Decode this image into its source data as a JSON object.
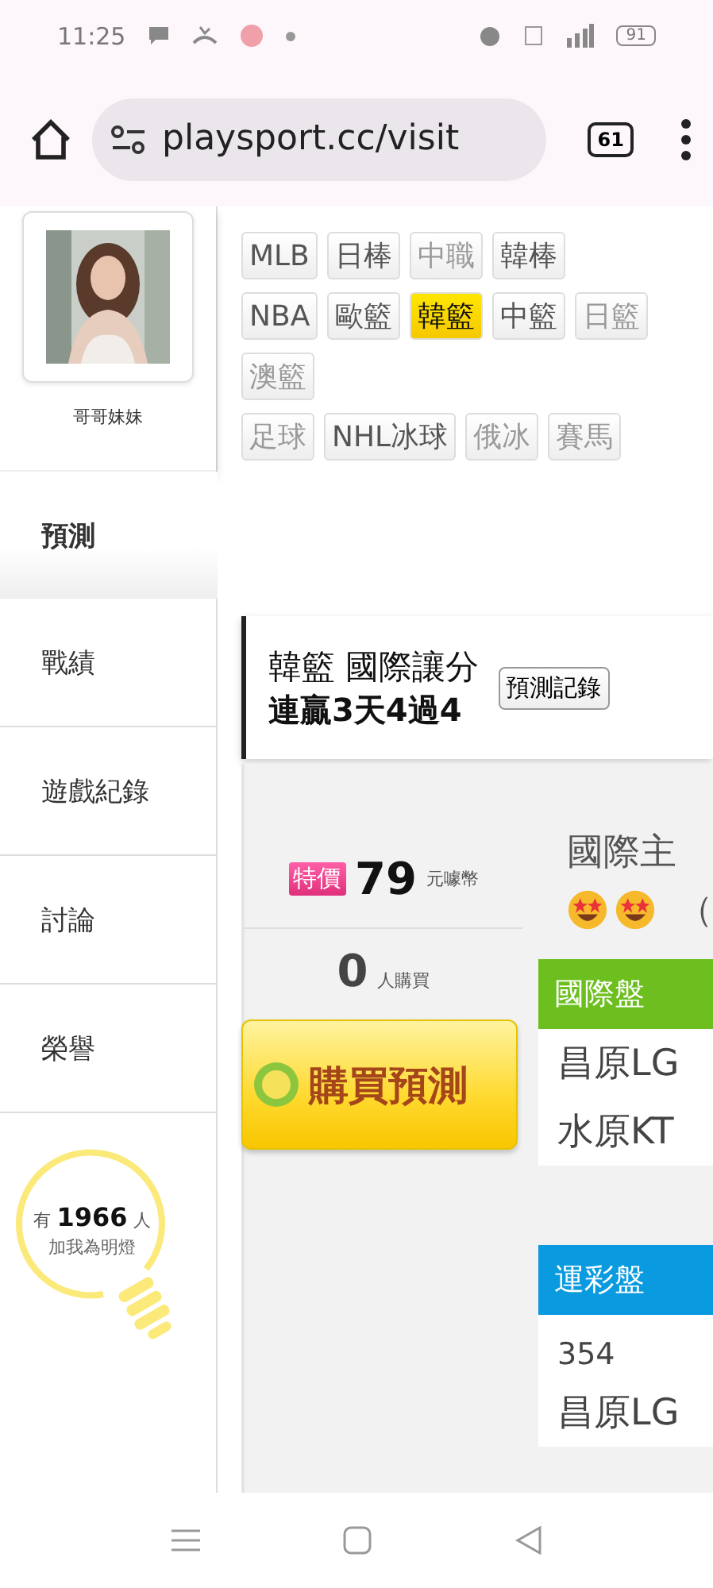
{
  "status_bar": {
    "time": "11:25",
    "battery": "91"
  },
  "browser": {
    "url": "playsport.cc/visit",
    "tab_count": "61"
  },
  "profile": {
    "name": "哥哥妹妹"
  },
  "nav": [
    {
      "label": "預測",
      "selected": true
    },
    {
      "label": "戰績",
      "selected": false
    },
    {
      "label": "遊戲紀錄",
      "selected": false
    },
    {
      "label": "討論",
      "selected": false
    },
    {
      "label": "榮譽",
      "selected": false
    }
  ],
  "fan_widget": {
    "count_text": "有 **1966** 人",
    "caption": "加我為明燈"
  },
  "tag_groups": [
    [
      {
        "label": "MLB",
        "disabled": false,
        "selected": false
      },
      {
        "label": "日棒",
        "disabled": false,
        "selected": false
      },
      {
        "label": "中職",
        "disabled": true,
        "selected": false
      },
      {
        "label": "韓棒",
        "disabled": false,
        "selected": false
      }
    ],
    [
      {
        "label": "NBA",
        "disabled": false,
        "selected": false
      },
      {
        "label": "歐籃",
        "disabled": false,
        "selected": false
      },
      {
        "label": "韓籃",
        "disabled": false,
        "selected": true
      },
      {
        "label": "中籃",
        "disabled": false,
        "selected": false
      },
      {
        "label": "日籃",
        "disabled": true,
        "selected": false
      },
      {
        "label": "澳籃",
        "disabled": true,
        "selected": false
      }
    ],
    [
      {
        "label": "足球",
        "disabled": true,
        "selected": false
      },
      {
        "label": "NHL冰球",
        "disabled": false,
        "selected": false
      },
      {
        "label": "俄冰",
        "disabled": true,
        "selected": false
      },
      {
        "label": "賽馬",
        "disabled": true,
        "selected": false
      }
    ]
  ],
  "header": {
    "title": "韓籃 國際讓分",
    "streak": "連贏3天4過4",
    "button": "預測記錄"
  },
  "offer": {
    "badge": "特價",
    "price": "79",
    "unit": "元噱幣",
    "buyers": "0",
    "buyers_unit": "人購買",
    "buy_button": "購買預測"
  },
  "pick": {
    "title": "國際主",
    "emojis": [
      {
        "kind": "star_eyes"
      },
      {
        "kind": "star_eyes"
      }
    ],
    "note": "（"
  },
  "sections": [
    {
      "title": "國際盤",
      "color": "#6cbf1e",
      "lines": [
        "昌原LG",
        "水原KT"
      ]
    },
    {
      "title": "運彩盤",
      "color": "#0a9ae0",
      "lines": [
        "354",
        "昌原LG"
      ]
    }
  ]
}
